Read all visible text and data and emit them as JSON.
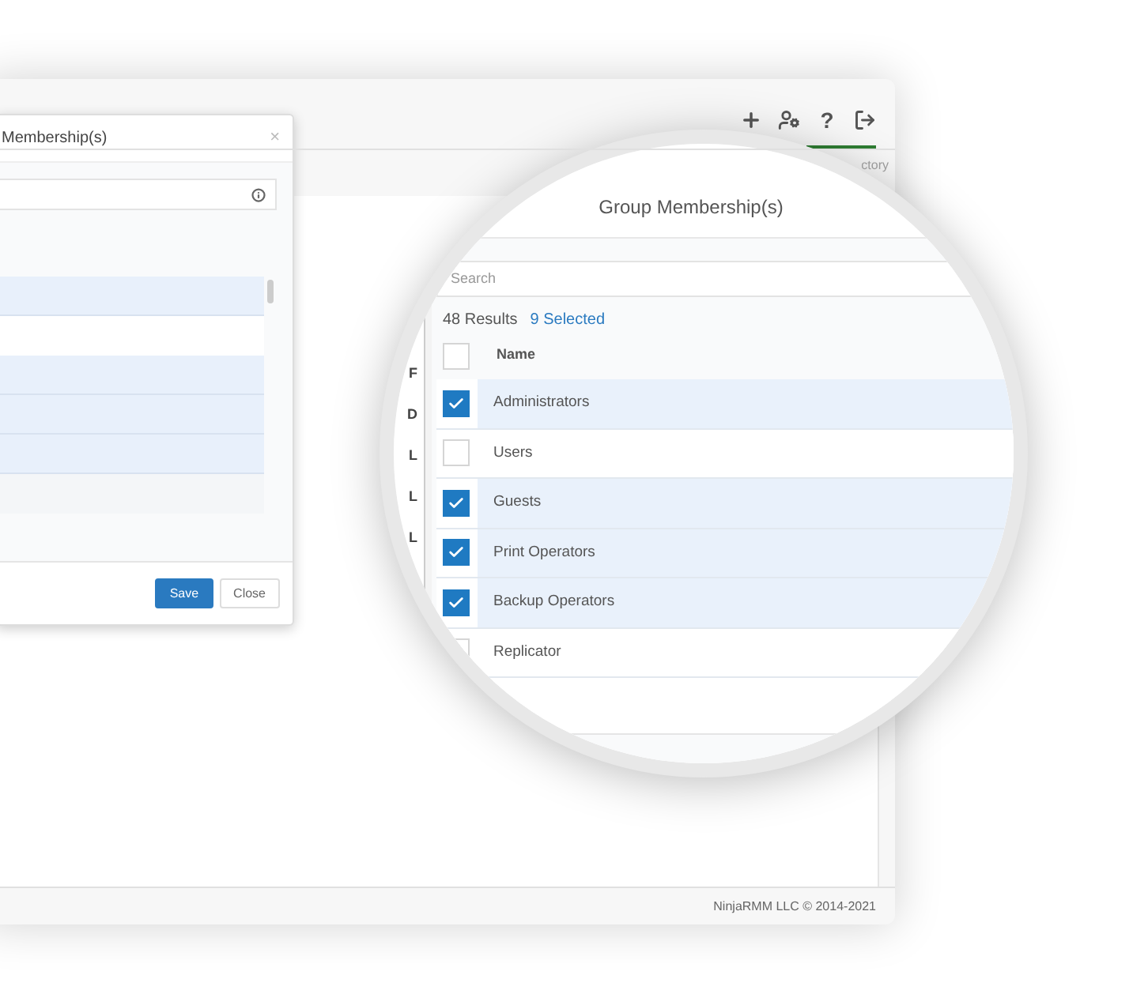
{
  "app": {
    "toolbar": [
      {
        "kind": "plus"
      },
      {
        "kind": "user-settings"
      },
      {
        "kind": "help",
        "glyph": "?"
      },
      {
        "kind": "logout"
      }
    ],
    "tab_fragment": "ctory",
    "footer": "NinjaRMM LLC © 2014-2021"
  },
  "modal": {
    "title": "Membership(s)",
    "close": "×",
    "rows": [
      {
        "selected": true
      },
      {
        "selected": false
      },
      {
        "selected": true
      },
      {
        "selected": true
      },
      {
        "selected": true
      }
    ],
    "buttons": [
      {
        "label": "Save",
        "kind": "primary"
      },
      {
        "label": "Close",
        "kind": "default"
      }
    ]
  },
  "magnifier": {
    "side_labels": [
      "F",
      "D",
      "L",
      "L",
      "L"
    ],
    "title": "Group Membership(s)",
    "search": {
      "placeholder": "Search"
    },
    "results": "48 Results",
    "selected_count": "9 Selected",
    "header": {
      "label": "Name",
      "checked": false
    },
    "rows": [
      {
        "name": "Administrators",
        "checked": true
      },
      {
        "name": "Users",
        "checked": false
      },
      {
        "name": "Guests",
        "checked": true
      },
      {
        "name": "Print Operators",
        "checked": true
      },
      {
        "name": "Backup Operators",
        "checked": true
      },
      {
        "name": "Replicator",
        "checked": false
      }
    ]
  }
}
